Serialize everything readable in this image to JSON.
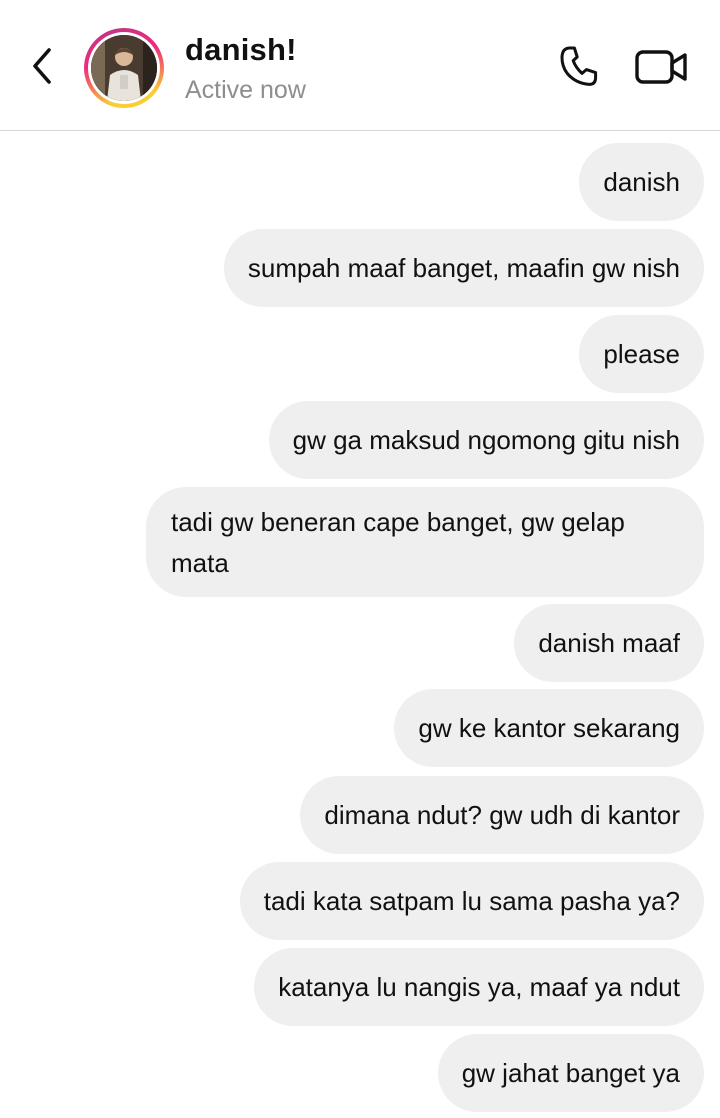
{
  "header": {
    "contact_name": "danish!",
    "status": "Active now",
    "icons": {
      "back": "chevron-left-icon",
      "call": "phone-icon",
      "video": "video-camera-icon"
    }
  },
  "messages": [
    {
      "text": "danish"
    },
    {
      "text": "sumpah maaf banget, maafin gw nish"
    },
    {
      "text": "please"
    },
    {
      "text": "gw ga maksud ngomong gitu nish"
    },
    {
      "text": "tadi gw beneran cape banget, gw gelap mata"
    },
    {
      "text": "danish maaf"
    },
    {
      "text": "gw ke kantor sekarang"
    },
    {
      "text": "dimana ndut? gw udh di kantor"
    },
    {
      "text": "tadi kata satpam lu sama pasha ya?"
    },
    {
      "text": "katanya lu nangis ya, maaf ya ndut"
    },
    {
      "text": "gw jahat banget ya"
    }
  ],
  "colors": {
    "bubble": "#efefef",
    "divider": "#d6d6d6",
    "status_text": "#8e8e8e",
    "ring_start": "#f9ce34",
    "ring_mid": "#ee2a7b"
  }
}
